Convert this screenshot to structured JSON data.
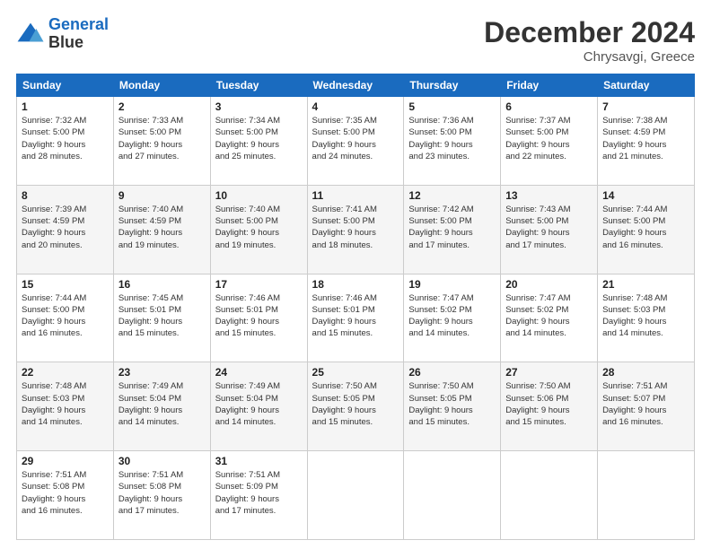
{
  "header": {
    "logo_line1": "General",
    "logo_line2": "Blue",
    "month": "December 2024",
    "location": "Chrysavgi, Greece"
  },
  "weekdays": [
    "Sunday",
    "Monday",
    "Tuesday",
    "Wednesday",
    "Thursday",
    "Friday",
    "Saturday"
  ],
  "weeks": [
    [
      {
        "day": "1",
        "info": "Sunrise: 7:32 AM\nSunset: 5:00 PM\nDaylight: 9 hours\nand 28 minutes."
      },
      {
        "day": "2",
        "info": "Sunrise: 7:33 AM\nSunset: 5:00 PM\nDaylight: 9 hours\nand 27 minutes."
      },
      {
        "day": "3",
        "info": "Sunrise: 7:34 AM\nSunset: 5:00 PM\nDaylight: 9 hours\nand 25 minutes."
      },
      {
        "day": "4",
        "info": "Sunrise: 7:35 AM\nSunset: 5:00 PM\nDaylight: 9 hours\nand 24 minutes."
      },
      {
        "day": "5",
        "info": "Sunrise: 7:36 AM\nSunset: 5:00 PM\nDaylight: 9 hours\nand 23 minutes."
      },
      {
        "day": "6",
        "info": "Sunrise: 7:37 AM\nSunset: 5:00 PM\nDaylight: 9 hours\nand 22 minutes."
      },
      {
        "day": "7",
        "info": "Sunrise: 7:38 AM\nSunset: 4:59 PM\nDaylight: 9 hours\nand 21 minutes."
      }
    ],
    [
      {
        "day": "8",
        "info": "Sunrise: 7:39 AM\nSunset: 4:59 PM\nDaylight: 9 hours\nand 20 minutes."
      },
      {
        "day": "9",
        "info": "Sunrise: 7:40 AM\nSunset: 4:59 PM\nDaylight: 9 hours\nand 19 minutes."
      },
      {
        "day": "10",
        "info": "Sunrise: 7:40 AM\nSunset: 5:00 PM\nDaylight: 9 hours\nand 19 minutes."
      },
      {
        "day": "11",
        "info": "Sunrise: 7:41 AM\nSunset: 5:00 PM\nDaylight: 9 hours\nand 18 minutes."
      },
      {
        "day": "12",
        "info": "Sunrise: 7:42 AM\nSunset: 5:00 PM\nDaylight: 9 hours\nand 17 minutes."
      },
      {
        "day": "13",
        "info": "Sunrise: 7:43 AM\nSunset: 5:00 PM\nDaylight: 9 hours\nand 17 minutes."
      },
      {
        "day": "14",
        "info": "Sunrise: 7:44 AM\nSunset: 5:00 PM\nDaylight: 9 hours\nand 16 minutes."
      }
    ],
    [
      {
        "day": "15",
        "info": "Sunrise: 7:44 AM\nSunset: 5:00 PM\nDaylight: 9 hours\nand 16 minutes."
      },
      {
        "day": "16",
        "info": "Sunrise: 7:45 AM\nSunset: 5:01 PM\nDaylight: 9 hours\nand 15 minutes."
      },
      {
        "day": "17",
        "info": "Sunrise: 7:46 AM\nSunset: 5:01 PM\nDaylight: 9 hours\nand 15 minutes."
      },
      {
        "day": "18",
        "info": "Sunrise: 7:46 AM\nSunset: 5:01 PM\nDaylight: 9 hours\nand 15 minutes."
      },
      {
        "day": "19",
        "info": "Sunrise: 7:47 AM\nSunset: 5:02 PM\nDaylight: 9 hours\nand 14 minutes."
      },
      {
        "day": "20",
        "info": "Sunrise: 7:47 AM\nSunset: 5:02 PM\nDaylight: 9 hours\nand 14 minutes."
      },
      {
        "day": "21",
        "info": "Sunrise: 7:48 AM\nSunset: 5:03 PM\nDaylight: 9 hours\nand 14 minutes."
      }
    ],
    [
      {
        "day": "22",
        "info": "Sunrise: 7:48 AM\nSunset: 5:03 PM\nDaylight: 9 hours\nand 14 minutes."
      },
      {
        "day": "23",
        "info": "Sunrise: 7:49 AM\nSunset: 5:04 PM\nDaylight: 9 hours\nand 14 minutes."
      },
      {
        "day": "24",
        "info": "Sunrise: 7:49 AM\nSunset: 5:04 PM\nDaylight: 9 hours\nand 14 minutes."
      },
      {
        "day": "25",
        "info": "Sunrise: 7:50 AM\nSunset: 5:05 PM\nDaylight: 9 hours\nand 15 minutes."
      },
      {
        "day": "26",
        "info": "Sunrise: 7:50 AM\nSunset: 5:05 PM\nDaylight: 9 hours\nand 15 minutes."
      },
      {
        "day": "27",
        "info": "Sunrise: 7:50 AM\nSunset: 5:06 PM\nDaylight: 9 hours\nand 15 minutes."
      },
      {
        "day": "28",
        "info": "Sunrise: 7:51 AM\nSunset: 5:07 PM\nDaylight: 9 hours\nand 16 minutes."
      }
    ],
    [
      {
        "day": "29",
        "info": "Sunrise: 7:51 AM\nSunset: 5:08 PM\nDaylight: 9 hours\nand 16 minutes."
      },
      {
        "day": "30",
        "info": "Sunrise: 7:51 AM\nSunset: 5:08 PM\nDaylight: 9 hours\nand 17 minutes."
      },
      {
        "day": "31",
        "info": "Sunrise: 7:51 AM\nSunset: 5:09 PM\nDaylight: 9 hours\nand 17 minutes."
      },
      null,
      null,
      null,
      null
    ]
  ]
}
